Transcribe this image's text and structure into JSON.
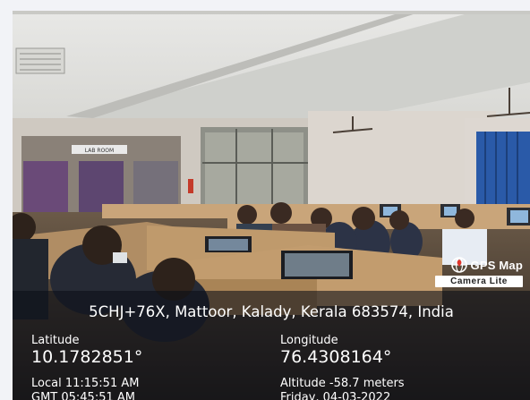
{
  "badge": {
    "brand": "GPS Map",
    "subtitle": "Camera Lite",
    "icon": "globe-icon"
  },
  "overlay": {
    "address": "5CHJ+76X, Mattoor, Kalady, Kerala 683574, India",
    "latitude_label": "Latitude",
    "latitude_value": "10.1782851°",
    "longitude_label": "Longitude",
    "longitude_value": "76.4308164°",
    "local_time": "Local 11:15:51 AM",
    "gmt_time": "GMT 05:45:51 AM",
    "altitude": "Altitude -58.7 meters",
    "date": "Friday, 04-03-2022"
  },
  "scene": {
    "wall_sign": "LAB ROOM"
  }
}
